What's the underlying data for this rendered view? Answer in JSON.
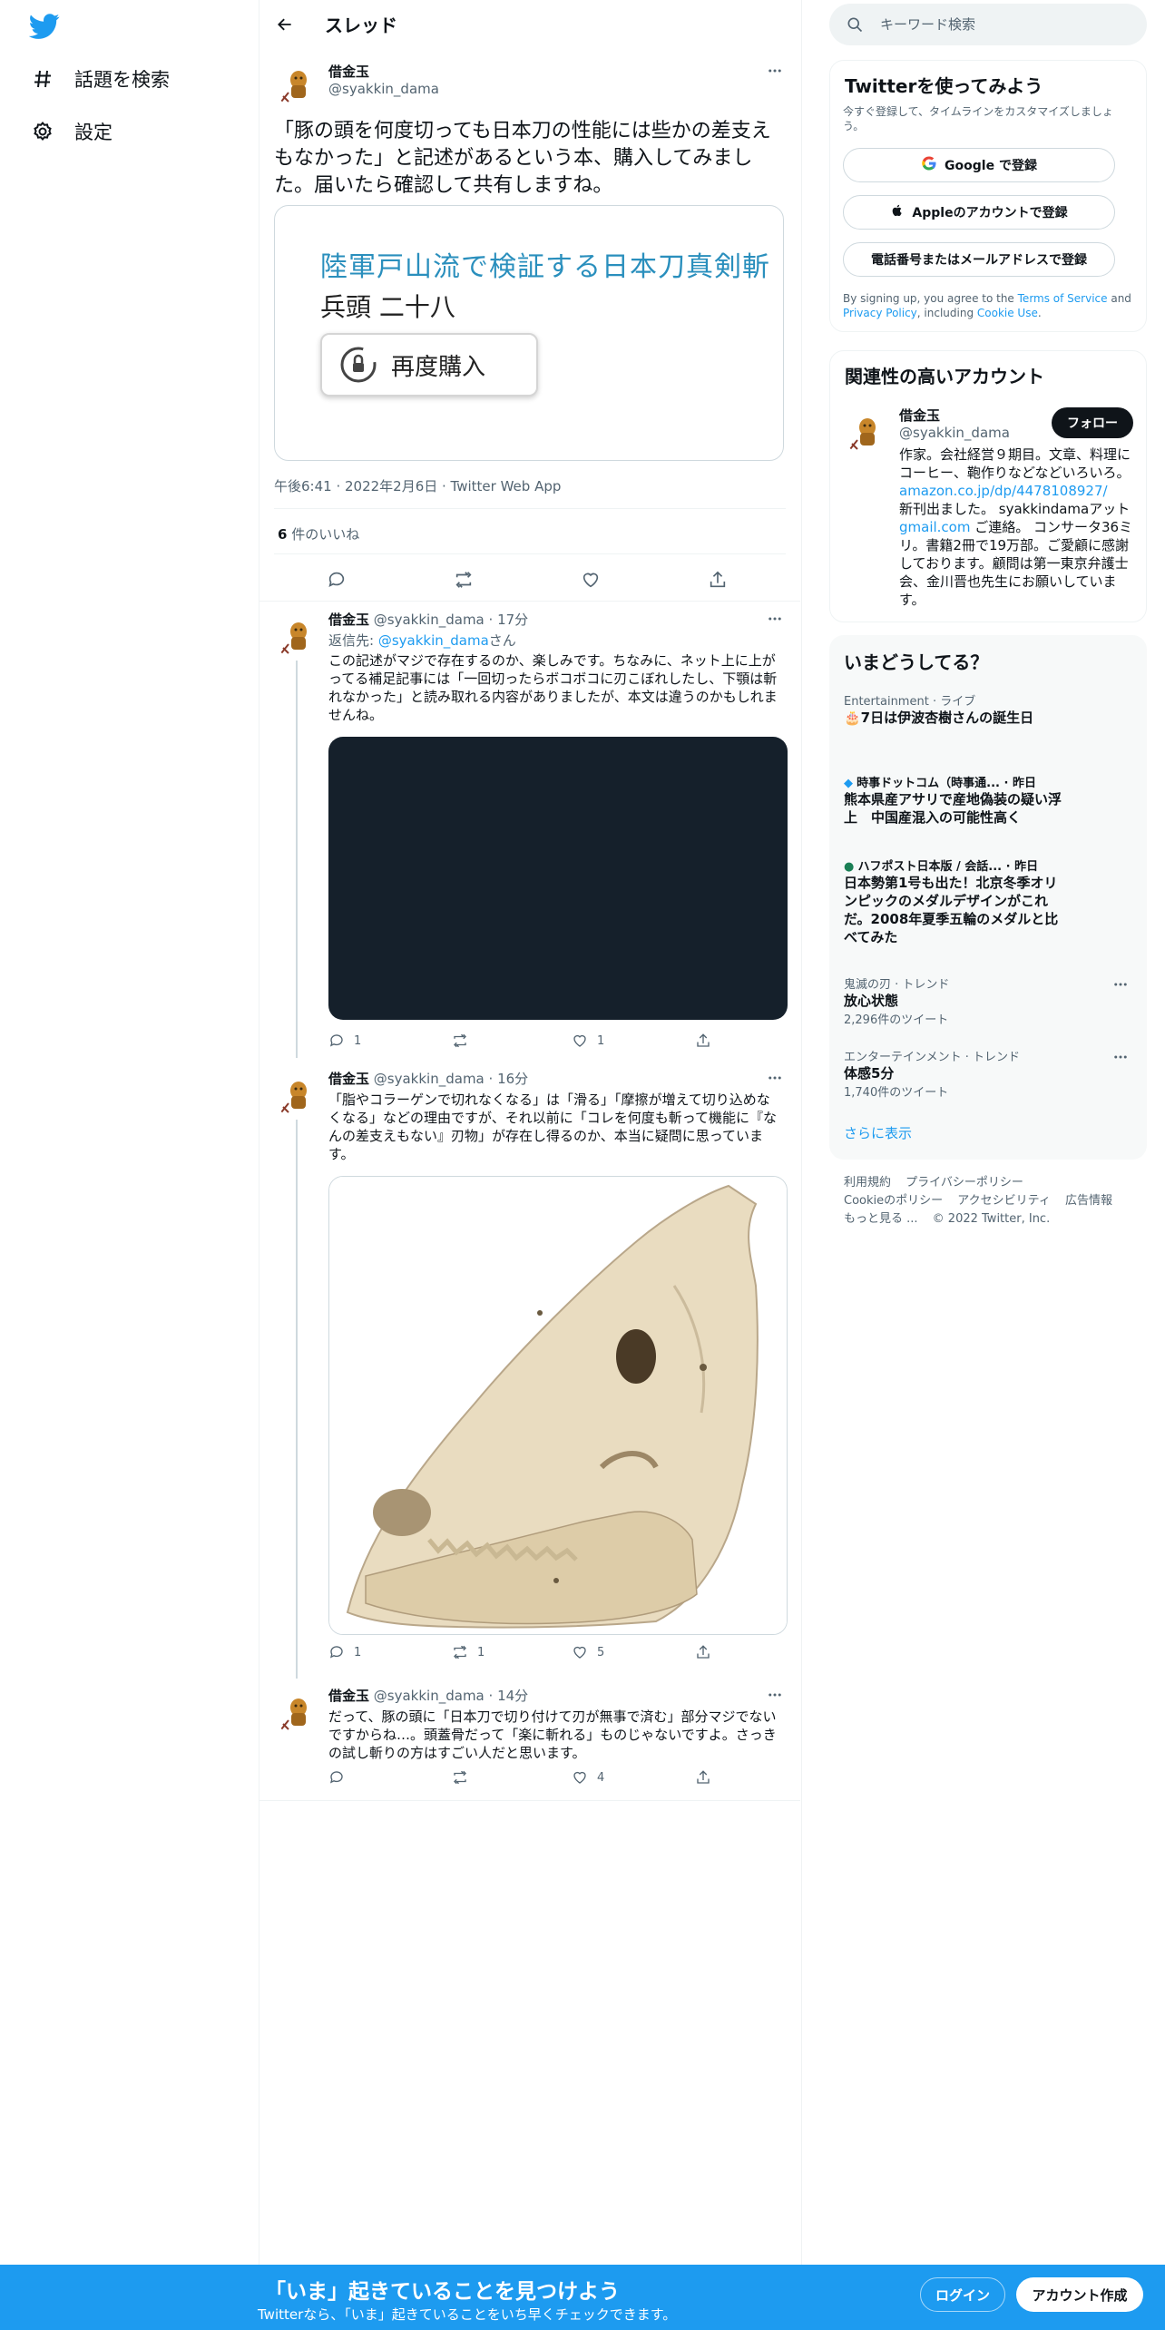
{
  "nav": {
    "items": [
      {
        "label": "話題を検索",
        "icon": "hashtag-icon"
      },
      {
        "label": "設定",
        "icon": "gear-icon"
      }
    ]
  },
  "header": {
    "title": "スレッド"
  },
  "main_tweet": {
    "name": "借金玉",
    "handle": "@syakkin_dama",
    "text": "「豚の頭を何度切っても日本刀の性能には些かの差支えもなかった」と記述があるという本、購入してみました。届いたら確認して共有しますね。",
    "card": {
      "line1": "陸軍戸山流で検証する日本刀真剣斬",
      "line2": "兵頭 二十八",
      "button": "再度購入"
    },
    "meta": "午後6:41 · 2022年2月6日 · Twitter Web App",
    "likes_count": "6",
    "likes_label": " 件のいいね"
  },
  "replies": [
    {
      "name": "借金玉",
      "handle": "@syakkin_dama",
      "time": "· 17分",
      "reply_to_label": "返信先: ",
      "reply_to_handle": "@syakkin_dama",
      "reply_to_suffix": "さん",
      "text": "この記述がマジで存在するのか、楽しみです。ちなみに、ネット上に上がってる補足記事には「一回切ったらボコボコに刃こぼれしたし、下顎は斬れなかった」と読み取れる内容がありましたが、本文は違うのかもしれませんね。",
      "replies": "1",
      "retweets": "",
      "likes": "1"
    },
    {
      "name": "借金玉",
      "handle": "@syakkin_dama",
      "time": "· 16分",
      "text": "「脂やコラーゲンで切れなくなる」は「滑る」「摩擦が増えて切り込めなくなる」などの理由ですが、それ以前に「コレを何度も斬って機能に『なんの差支えもない』刃物」が存在し得るのか、本当に疑問に思っています。",
      "replies": "1",
      "retweets": "1",
      "likes": "5"
    },
    {
      "name": "借金玉",
      "handle": "@syakkin_dama",
      "time": "· 14分",
      "text": "だって、豚の頭に「日本刀で切り付けて刃が無事で済む」部分マジでないですからね…。頭蓋骨だって「楽に斬れる」ものじゃないですよ。さっきの試し斬りの方はすごい人だと思います。",
      "replies": "",
      "retweets": "",
      "likes": "4"
    }
  ],
  "search": {
    "placeholder": "キーワード検索"
  },
  "signup": {
    "title": "Twitterを使ってみよう",
    "subtitle": "今すぐ登録して、タイムラインをカスタマイズしましょう。",
    "google": "Google で登録",
    "apple": "Appleのアカウントで登録",
    "phone": "電話番号またはメールアドレスで登録",
    "terms_pre": "By signing up, you agree to the ",
    "terms_link": "Terms of Service",
    "terms_and": " and ",
    "privacy_link": "Privacy Policy",
    "terms_including": ", including ",
    "cookie_link": "Cookie Use",
    "terms_end": "."
  },
  "related": {
    "title": "関連性の高いアカウント",
    "name": "借金玉",
    "handle": "@syakkin_dama",
    "follow": "フォロー",
    "bio_1": "作家。会社経営９期目。文章、料理にコーヒー、鞄作りなどなどいろいろ。",
    "bio_link": "amazon.co.jp/dp/4478108927/",
    "bio_2": "新刊出ました。 syakkindamaアット",
    "bio_link2": "gmail.com",
    "bio_3": " ご連絡。 コンサータ36ミリ。書籍2冊で19万部。ご愛顧に感謝しております。顧問は第一東京弁護士会、金川晋也先生にお願いしています。"
  },
  "trends": {
    "title": "いまどうしてる？",
    "items": [
      {
        "category": "Entertainment · ライブ",
        "title": "🎂7日は伊波杏樹さんの誕生日",
        "count": ""
      },
      {
        "category": "時事ドットコム（時事通... · 昨日",
        "title": "熊本県産アサリで産地偽装の疑い浮上　中国産混入の可能性高く",
        "count": ""
      },
      {
        "category": "ハフポスト日本版 / 会話... · 昨日",
        "title": "日本勢第1号も出た！北京冬季オリンピックのメダルデザインがこれだ。2008年夏季五輪のメダルと比べてみた",
        "count": ""
      },
      {
        "category": "鬼滅の刃 · トレンド",
        "title": "放心状態",
        "count": "2,296件のツイート"
      },
      {
        "category": "エンターテインメント · トレンド",
        "title": "体感5分",
        "count": "1,740件のツイート"
      }
    ],
    "show_more": "さらに表示"
  },
  "footer": {
    "links": [
      "利用規約",
      "プライバシーポリシー",
      "Cookieのポリシー",
      "アクセシビリティ",
      "広告情報",
      "もっと見る ..."
    ],
    "copyright": "© 2022 Twitter, Inc."
  },
  "bottom_bar": {
    "title": "「いま」起きていることを見つけよう",
    "subtitle": "Twitterなら、「いま」起きていることをいち早くチェックできます。",
    "login": "ログイン",
    "signup": "アカウント作成"
  },
  "colors": {
    "accent": "#1d9bf0",
    "text": "#0f1419",
    "muted": "#536471",
    "border": "#eff3f4"
  }
}
